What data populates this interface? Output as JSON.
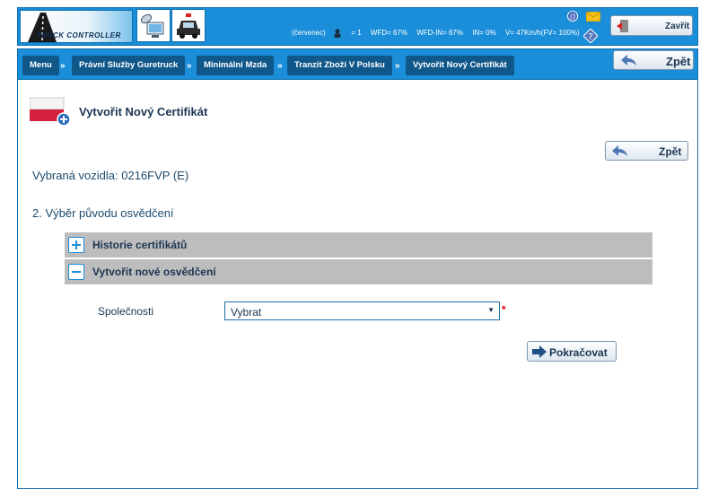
{
  "header": {
    "logo_text": "TRUCK CONTROLLER",
    "status": {
      "month": "(červenec)",
      "persons": "= 1",
      "wfd": "WFD= 67%",
      "wfd_in": "WFD-IN= 67%",
      "in": "IN= 0%",
      "speed": "V= 47Km/h(FV= 100%)"
    },
    "at_symbol": "@",
    "help_symbol": "?",
    "close_label": "Zavřít"
  },
  "breadcrumb": {
    "items": [
      "Menu",
      "Právní Služby Guretruck",
      "Minimální Mzda",
      "Tranzit Zboží V Polsku",
      "Vytvořit Nový Certifikát"
    ],
    "separator": "»",
    "back_label": "Zpět"
  },
  "main": {
    "page_title": "Vytvořit Nový Certifikát",
    "back_label": "Zpět",
    "vehicle_text": "Vybraná vozidla: 0216FVP (E)",
    "step_title": "2. Výběr původu osvědčení",
    "accordion": [
      {
        "label": "Historie certifikátů",
        "state": "collapsed"
      },
      {
        "label": "Vytvořit nové osvědčení",
        "state": "expanded"
      }
    ],
    "form": {
      "company_label": "Společnosti",
      "company_value": "Vybrat",
      "required_mark": "*"
    },
    "continue_label": "Pokračovat"
  },
  "colors": {
    "header_blue": "#1a8ed8",
    "crumb_dark": "#10578a",
    "accordion_gray": "#bdbdbd",
    "text_dark": "#1b3552",
    "required_red": "#e0001b"
  },
  "icons": [
    "truck-road-logo",
    "satellite-computer-icon",
    "police-car-icon",
    "person-icon",
    "at-icon",
    "mail-icon",
    "help-icon",
    "exit-door-icon",
    "back-arrow-icon",
    "poland-flag-add-icon",
    "plus-icon",
    "minus-icon",
    "forward-arrow-icon"
  ]
}
